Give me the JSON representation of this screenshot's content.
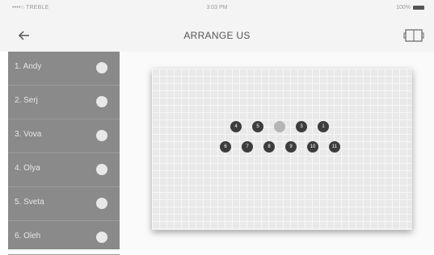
{
  "status_bar": {
    "carrier": "••••○ TREBLE",
    "time": "3:03 PM",
    "battery": "100%"
  },
  "nav": {
    "title": "ARRANGE US",
    "back_icon": "arrow-left-icon",
    "right_icon": "pitch-icon"
  },
  "players": [
    {
      "label": "1. Andy"
    },
    {
      "label": "2. Serj"
    },
    {
      "label": "3. Vova"
    },
    {
      "label": "4. Olya"
    },
    {
      "label": "5. Sveta"
    },
    {
      "label": "6. Oleh"
    }
  ],
  "board": {
    "tokens_row1": [
      "4",
      "5",
      "",
      "3",
      "1"
    ],
    "tokens_row2": [
      "6",
      "7",
      "8",
      "9",
      "10",
      "11"
    ]
  },
  "colors": {
    "sidebar_bg": "#8a8a8a",
    "token": "#3c3c3c",
    "token_inactive": "#b5b5b5"
  }
}
